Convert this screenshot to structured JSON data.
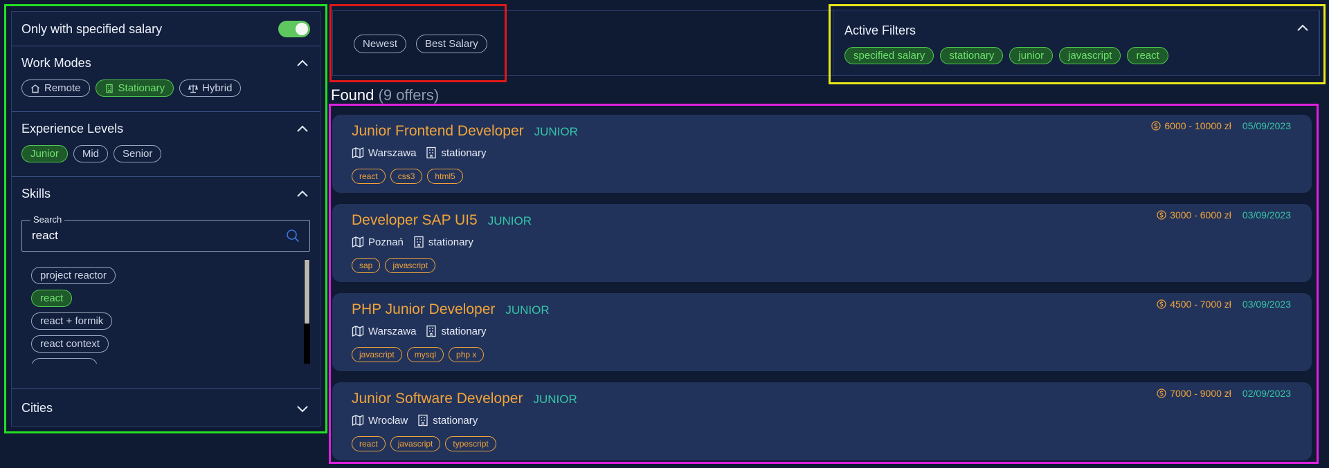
{
  "sidebar": {
    "salary_toggle": {
      "label": "Only with specified salary",
      "on": true
    },
    "work_modes": {
      "title": "Work Modes",
      "items": [
        {
          "label": "Remote",
          "icon": "home-icon",
          "active": false
        },
        {
          "label": "Stationary",
          "icon": "building-icon",
          "active": true
        },
        {
          "label": "Hybrid",
          "icon": "scale-icon",
          "active": false
        }
      ]
    },
    "experience": {
      "title": "Experience Levels",
      "items": [
        {
          "label": "Junior",
          "active": true
        },
        {
          "label": "Mid",
          "active": false
        },
        {
          "label": "Senior",
          "active": false
        }
      ]
    },
    "skills": {
      "title": "Skills",
      "search_label": "Search",
      "search_value": "react",
      "items": [
        {
          "label": "project reactor",
          "active": false
        },
        {
          "label": "react",
          "active": true
        },
        {
          "label": "react + formik",
          "active": false
        },
        {
          "label": "react context",
          "active": false
        }
      ]
    },
    "cities": {
      "title": "Cities"
    }
  },
  "sort": {
    "options": [
      "Newest",
      "Best Salary"
    ]
  },
  "active_filters": {
    "title": "Active Filters",
    "chips": [
      "specified salary",
      "stationary",
      "junior",
      "javascript",
      "react"
    ]
  },
  "results": {
    "found_label": "Found",
    "count_label": "(9 offers)"
  },
  "offers": [
    {
      "title": "Junior Frontend Developer",
      "level": "JUNIOR",
      "city": "Warszawa",
      "mode": "stationary",
      "tags": [
        "react",
        "css3",
        "html5"
      ],
      "salary": "6000 - 10000 zł",
      "date": "05/09/2023"
    },
    {
      "title": "Developer SAP UI5",
      "level": "JUNIOR",
      "city": "Poznań",
      "mode": "stationary",
      "tags": [
        "sap",
        "javascript"
      ],
      "salary": "3000 - 6000 zł",
      "date": "03/09/2023"
    },
    {
      "title": "PHP Junior Developer",
      "level": "JUNIOR",
      "city": "Warszawa",
      "mode": "stationary",
      "tags": [
        "javascript",
        "mysql",
        "php x"
      ],
      "salary": "4500 - 7000 zł",
      "date": "03/09/2023"
    },
    {
      "title": "Junior Software Developer",
      "level": "JUNIOR",
      "city": "Wrocław",
      "mode": "stationary",
      "tags": [
        "react",
        "javascript",
        "typescript"
      ],
      "salary": "7000 - 9000 zł",
      "date": "02/09/2023"
    }
  ],
  "colors": {
    "background": "#0f1a33",
    "accent_green": "#5ec85e",
    "accent_orange": "#f0a43a",
    "accent_teal": "#35c6a8"
  }
}
